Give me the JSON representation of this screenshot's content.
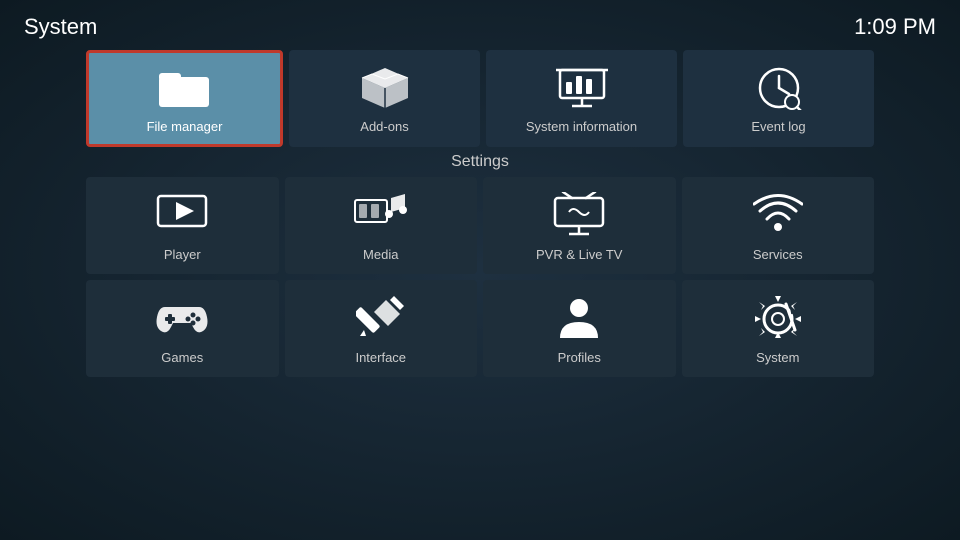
{
  "header": {
    "title": "System",
    "time": "1:09 PM"
  },
  "top_tiles": [
    {
      "id": "file-manager",
      "label": "File manager"
    },
    {
      "id": "add-ons",
      "label": "Add-ons"
    },
    {
      "id": "system-information",
      "label": "System information"
    },
    {
      "id": "event-log",
      "label": "Event log"
    }
  ],
  "settings_label": "Settings",
  "settings_tiles": [
    {
      "id": "player",
      "label": "Player"
    },
    {
      "id": "media",
      "label": "Media"
    },
    {
      "id": "pvr-live-tv",
      "label": "PVR & Live TV"
    },
    {
      "id": "services",
      "label": "Services"
    },
    {
      "id": "games",
      "label": "Games"
    },
    {
      "id": "interface",
      "label": "Interface"
    },
    {
      "id": "profiles",
      "label": "Profiles"
    },
    {
      "id": "system",
      "label": "System"
    }
  ]
}
